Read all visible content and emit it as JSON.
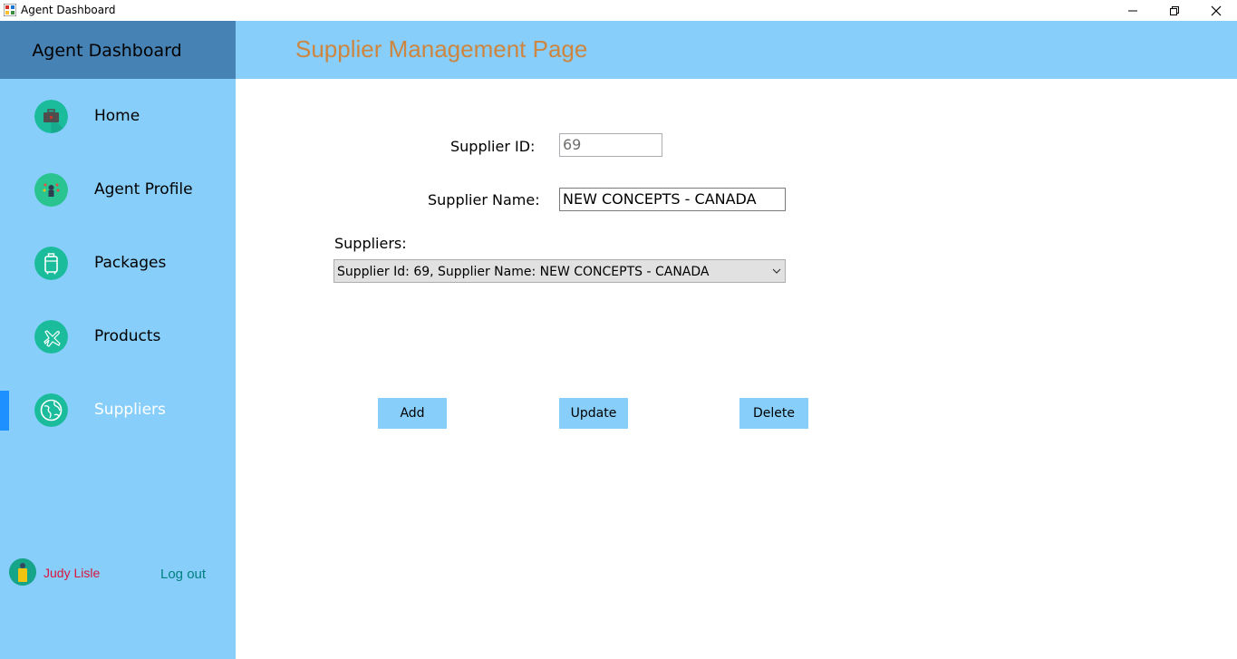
{
  "window": {
    "title": "Agent Dashboard"
  },
  "sidebar": {
    "title": "Agent Dashboard",
    "items": [
      {
        "label": "Home",
        "icon": "briefcase-icon"
      },
      {
        "label": "Agent Profile",
        "icon": "profile-icon"
      },
      {
        "label": "Packages",
        "icon": "luggage-icon"
      },
      {
        "label": "Products",
        "icon": "airplane-icon"
      },
      {
        "label": "Suppliers",
        "icon": "globe-icon",
        "active": true
      }
    ],
    "user": {
      "name": "Judy Lisle",
      "logout_label": "Log out"
    }
  },
  "main": {
    "title": "Supplier Management Page",
    "form": {
      "supplier_id_label": "Supplier ID:",
      "supplier_id_value": "69",
      "supplier_name_label": "Supplier Name:",
      "supplier_name_value": "NEW CONCEPTS - CANADA",
      "suppliers_label": "Suppliers:",
      "suppliers_selected": "Supplier Id: 69,   Supplier Name: NEW CONCEPTS - CANADA"
    },
    "buttons": {
      "add": "Add",
      "update": "Update",
      "delete": "Delete"
    }
  },
  "colors": {
    "sidebar_bg": "#87cefa",
    "sidebar_header_bg": "#4682b4",
    "title_color": "#cd853f",
    "active_indicator": "#1e90ff",
    "user_name_color": "#dc143c",
    "logout_color": "#008080",
    "icon_circle": "#1abc9c"
  }
}
